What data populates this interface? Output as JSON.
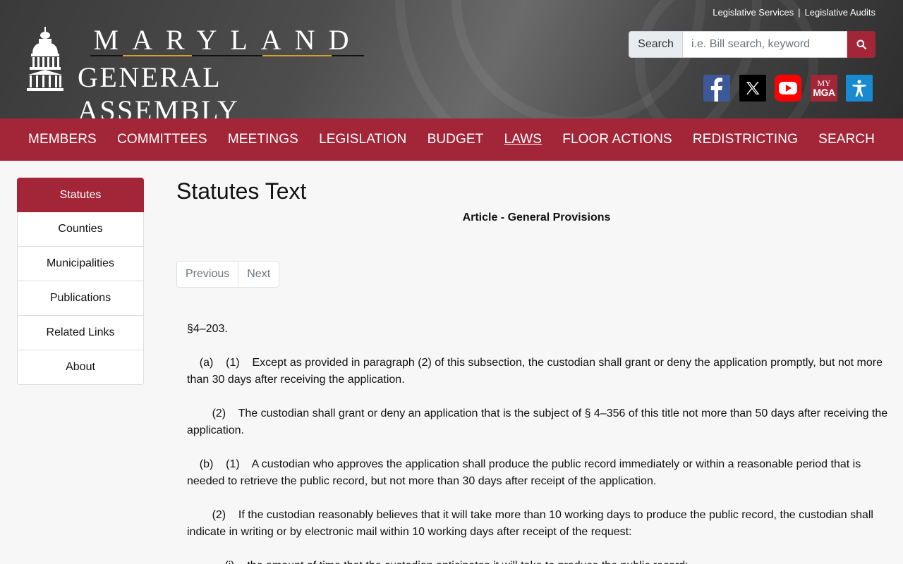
{
  "header": {
    "top_links": [
      "Legislative Services",
      "Legislative Audits"
    ],
    "top_link_separator": "|",
    "logo": {
      "line1": "MARYLAND",
      "line2": "GENERAL ASSEMBLY",
      "icon": "capitol-dome-icon",
      "accent_color": "#d4a12a"
    },
    "search": {
      "label": "Search",
      "placeholder": "i.e. Bill search, keyword",
      "button_icon": "search-icon"
    },
    "social": [
      {
        "name": "facebook-icon",
        "color": "#3b5998"
      },
      {
        "name": "x-icon",
        "color": "#000000"
      },
      {
        "name": "youtube-icon",
        "color": "#ff0000"
      },
      {
        "name": "mymga-icon",
        "color": "#a32638",
        "text": "MY MGA"
      },
      {
        "name": "accessibility-icon",
        "color": "#1a8ad0"
      }
    ]
  },
  "nav": {
    "items": [
      "MEMBERS",
      "COMMITTEES",
      "MEETINGS",
      "LEGISLATION",
      "BUDGET",
      "LAWS",
      "FLOOR ACTIONS",
      "REDISTRICTING",
      "SEARCH"
    ],
    "active": "LAWS",
    "color": "#a32638"
  },
  "sidebar": {
    "items": [
      "Statutes",
      "Counties",
      "Municipalities",
      "Publications",
      "Related Links",
      "About"
    ],
    "active": "Statutes"
  },
  "main": {
    "title": "Statutes Text",
    "article": "Article - General Provisions",
    "pager": {
      "previous": "Previous",
      "next": "Next"
    },
    "section": "§4–203.",
    "paragraphs": [
      "    (a)    (1)    Except as provided in paragraph (2) of this subsection, the custodian shall grant or deny the application promptly, but not more than 30 days after receiving the application.",
      "        (2)    The custodian shall grant or deny an application that is the subject of § 4–356 of this title not more than 50 days after receiving the application.",
      "    (b)    (1)    A custodian who approves the application shall produce the public record immediately or within a reasonable period that is needed to retrieve the public record, but not more than 30 days after receipt of the application.",
      "        (2)    If the custodian reasonably believes that it will take more than 10 working days to produce the public record, the custodian shall indicate in writing or by electronic mail within 10 working days after receipt of the request:",
      "            (i)    the amount of time that the custodian anticipates it will take to produce the public record;"
    ]
  }
}
